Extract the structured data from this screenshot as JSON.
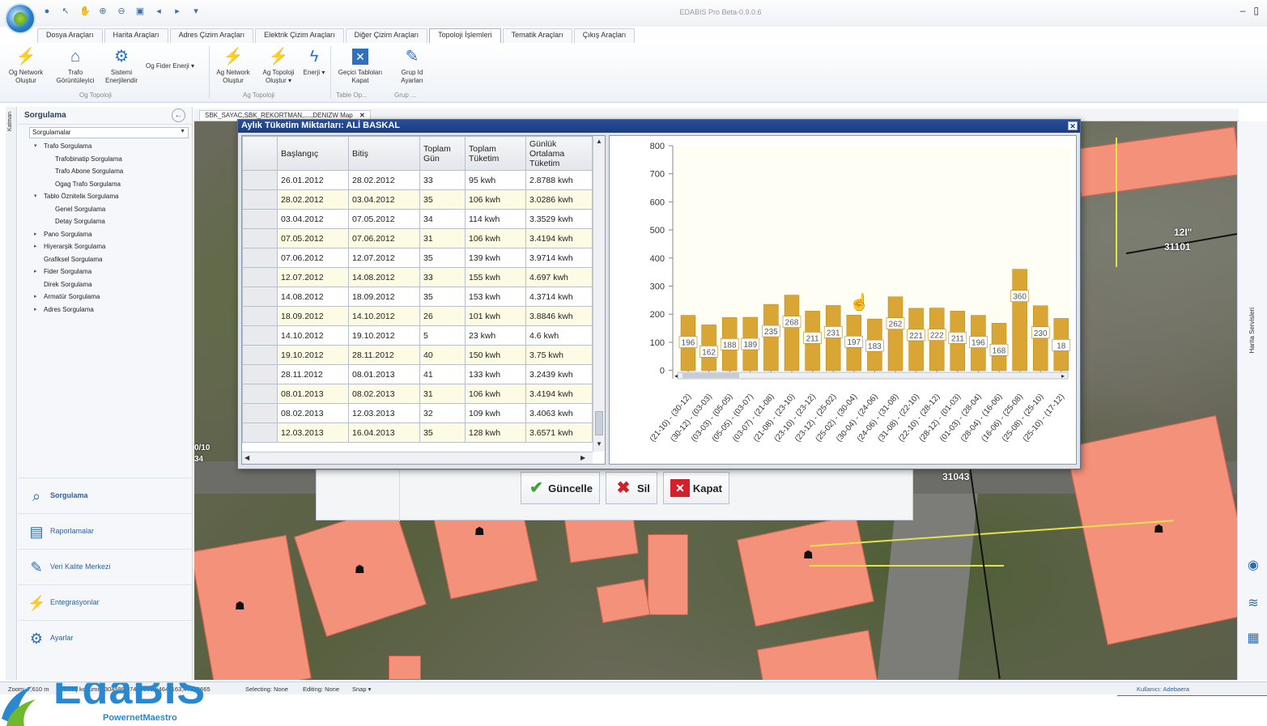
{
  "app": {
    "title": "EDABIS Pro Beta-0.9.0.6",
    "win_controls": [
      "–",
      "▯"
    ]
  },
  "ribbon": {
    "tabs": [
      {
        "label": "Dosya Araçları",
        "active": false
      },
      {
        "label": "Harita Araçları",
        "active": false
      },
      {
        "label": "Adres Çizim Araçları",
        "active": false
      },
      {
        "label": "Elektrik Çizim Araçları",
        "active": false
      },
      {
        "label": "Diğer Çizim Araçları",
        "active": false
      },
      {
        "label": "Topoloji İşlemleri",
        "active": true
      },
      {
        "label": "Tematik Araçları",
        "active": false
      },
      {
        "label": "Çıkış Araçları",
        "active": false
      }
    ],
    "buttons": {
      "og_network": "Og Network Oluştur",
      "trafo": "Trafo Görüntüleyici",
      "sistemi": "Sistemi Enerjilendir",
      "og_fider": "Og Fider Enerji ▾",
      "ag_network": "Ag Network Oluştur",
      "ag_topoloji": "Ag Topoloji Oluştur ▾",
      "enerji": "Enerji ▾",
      "gecici": "Geçici Tabloları Kapat",
      "grup_id": "Grup Id Ayarları"
    },
    "groups": {
      "og_topoloji": "Og Topoloji",
      "ag_topoloji": "Ag Topoloji",
      "table_op": "Table Op...",
      "grup": "Grup ..."
    }
  },
  "left_panel": {
    "strip_label": "Katman",
    "title": "Sorgulama",
    "combo_value": "Sorgulamalar",
    "tree": [
      {
        "label": "Trafo Sorgulama",
        "level": 1,
        "arrow": "▾"
      },
      {
        "label": "Trafobinatip Sorgulama",
        "level": 2,
        "arrow": ""
      },
      {
        "label": "Trafo Abone Sorgulama",
        "level": 2,
        "arrow": ""
      },
      {
        "label": "Ogag Trafo Sorgulama",
        "level": 2,
        "arrow": ""
      },
      {
        "label": "Tablo Özniteliк Sorgulama",
        "level": 1,
        "arrow": "▾"
      },
      {
        "label": "Genel Sorgulama",
        "level": 2,
        "arrow": ""
      },
      {
        "label": "Detay Sorgulama",
        "level": 2,
        "arrow": ""
      },
      {
        "label": "Pano Sorgulama",
        "level": 1,
        "arrow": "▸"
      },
      {
        "label": "Hiyerarşik Sorgulama",
        "level": 1,
        "arrow": "▸"
      },
      {
        "label": "Grafiksel Sorgulama",
        "level": 1,
        "arrow": ""
      },
      {
        "label": "Fider Sorgulama",
        "level": 1,
        "arrow": "▸"
      },
      {
        "label": "Direk Sorgulama",
        "level": 1,
        "arrow": ""
      },
      {
        "label": "Armatür Sorgulama",
        "level": 1,
        "arrow": "▸"
      },
      {
        "label": "Adres Sorgulama",
        "level": 1,
        "arrow": "▸"
      }
    ],
    "nav": [
      {
        "label": "Sorgulama",
        "icon": "search-icon",
        "active": true
      },
      {
        "label": "Raporlamalar",
        "icon": "report-icon",
        "active": false
      },
      {
        "label": "Veri Kalite Merkezi",
        "icon": "quality-icon",
        "active": false
      },
      {
        "label": "Entegrasyonlar",
        "icon": "plug-icon",
        "active": false
      },
      {
        "label": "Ayarlar",
        "icon": "gear-icon",
        "active": false
      }
    ]
  },
  "map": {
    "tab_label": "SBK_SAYAC,SBK_REKORTMAN,....,DENIZW Map",
    "labels": [
      "12I\"",
      "31101",
      "31043",
      "0/10",
      "34"
    ],
    "right_strip_label": "Harita Servisleri"
  },
  "dialog": {
    "title": "Aylık Tüketim Miktarları: ALİ BASKAL",
    "columns": [
      "Başlangıç",
      "Bitiş",
      "Toplam Gün",
      "Toplam Tüketim",
      "Günlük Ortalama Tüketim"
    ],
    "rows": [
      [
        "26.01.2012",
        "28.02.2012",
        "33",
        "95 kwh",
        "2.8788 kwh"
      ],
      [
        "28.02.2012",
        "03.04.2012",
        "35",
        "106 kwh",
        "3.0286 kwh"
      ],
      [
        "03.04.2012",
        "07.05.2012",
        "34",
        "114 kwh",
        "3.3529 kwh"
      ],
      [
        "07.05.2012",
        "07.06.2012",
        "31",
        "106 kwh",
        "3.4194 kwh"
      ],
      [
        "07.06.2012",
        "12.07.2012",
        "35",
        "139 kwh",
        "3.9714 kwh"
      ],
      [
        "12.07.2012",
        "14.08.2012",
        "33",
        "155 kwh",
        "4.697 kwh"
      ],
      [
        "14.08.2012",
        "18.09.2012",
        "35",
        "153 kwh",
        "4.3714 kwh"
      ],
      [
        "18.09.2012",
        "14.10.2012",
        "26",
        "101 kwh",
        "3.8846 kwh"
      ],
      [
        "14.10.2012",
        "19.10.2012",
        "5",
        "23 kwh",
        "4.6 kwh"
      ],
      [
        "19.10.2012",
        "28.11.2012",
        "40",
        "150 kwh",
        "3.75 kwh"
      ],
      [
        "28.11.2012",
        "08.01.2013",
        "41",
        "133 kwh",
        "3.2439 kwh"
      ],
      [
        "08.01.2013",
        "08.02.2013",
        "31",
        "106 kwh",
        "3.4194 kwh"
      ],
      [
        "08.02.2013",
        "12.03.2013",
        "32",
        "109 kwh",
        "3.4063 kwh"
      ],
      [
        "12.03.2013",
        "16.04.2013",
        "35",
        "128 kwh",
        "3.6571 kwh"
      ]
    ],
    "buttons": {
      "guncelle": "Güncelle",
      "sil": "Sil",
      "kapat": "Kapat"
    }
  },
  "chart_data": {
    "type": "bar",
    "categories": [
      "(21-10) - (30-12)",
      "(30-12) - (03-03)",
      "(03-03) - (05-05)",
      "(05-05) - (03-07)",
      "(03-07) - (21-08)",
      "(21-08) - (23-10)",
      "(23-10) - (23-12)",
      "(23-12) - (25-02)",
      "(25-02) - (30-04)",
      "(30-04) - (24-06)",
      "(24-06) - (31-08)",
      "(31-08) - (22-10)",
      "(22-10) - (28-12)",
      "(28-12) - (01-03)",
      "(01-03) - (28-04)",
      "(28-04) - (16-06)",
      "(16-06) - (25-08)",
      "(25-08) - (25-10)",
      "(25-10) - (17-12)"
    ],
    "values": [
      196,
      162,
      188,
      189,
      235,
      268,
      211,
      231,
      197,
      183,
      262,
      221,
      222,
      211,
      196,
      168,
      360,
      230,
      185
    ],
    "data_labels": [
      "196",
      "162",
      "188",
      "189",
      "235",
      "268",
      "211",
      "231",
      "197",
      "183",
      "262",
      "221",
      "222",
      "211",
      "196",
      "168",
      "360",
      "230",
      "18"
    ],
    "yticks": [
      0,
      100,
      200,
      300,
      400,
      500,
      600,
      700,
      800
    ],
    "ylim": [
      -30,
      800
    ],
    "title": "",
    "xlabel": "",
    "ylabel": "",
    "bar_color": "#d9a534"
  },
  "status": {
    "zoom": "Zoom: 7,610 m",
    "coords": "İmleç konumu: 3045992,74743632;4641163,47595665",
    "selecting": "Selecting: None",
    "editing": "Editing: None",
    "snap": "Snap ▾",
    "user": "Kullanıcı: Adebaera"
  },
  "brand": {
    "logo": "EdaBIS",
    "sub": "PowernetMaestro"
  }
}
